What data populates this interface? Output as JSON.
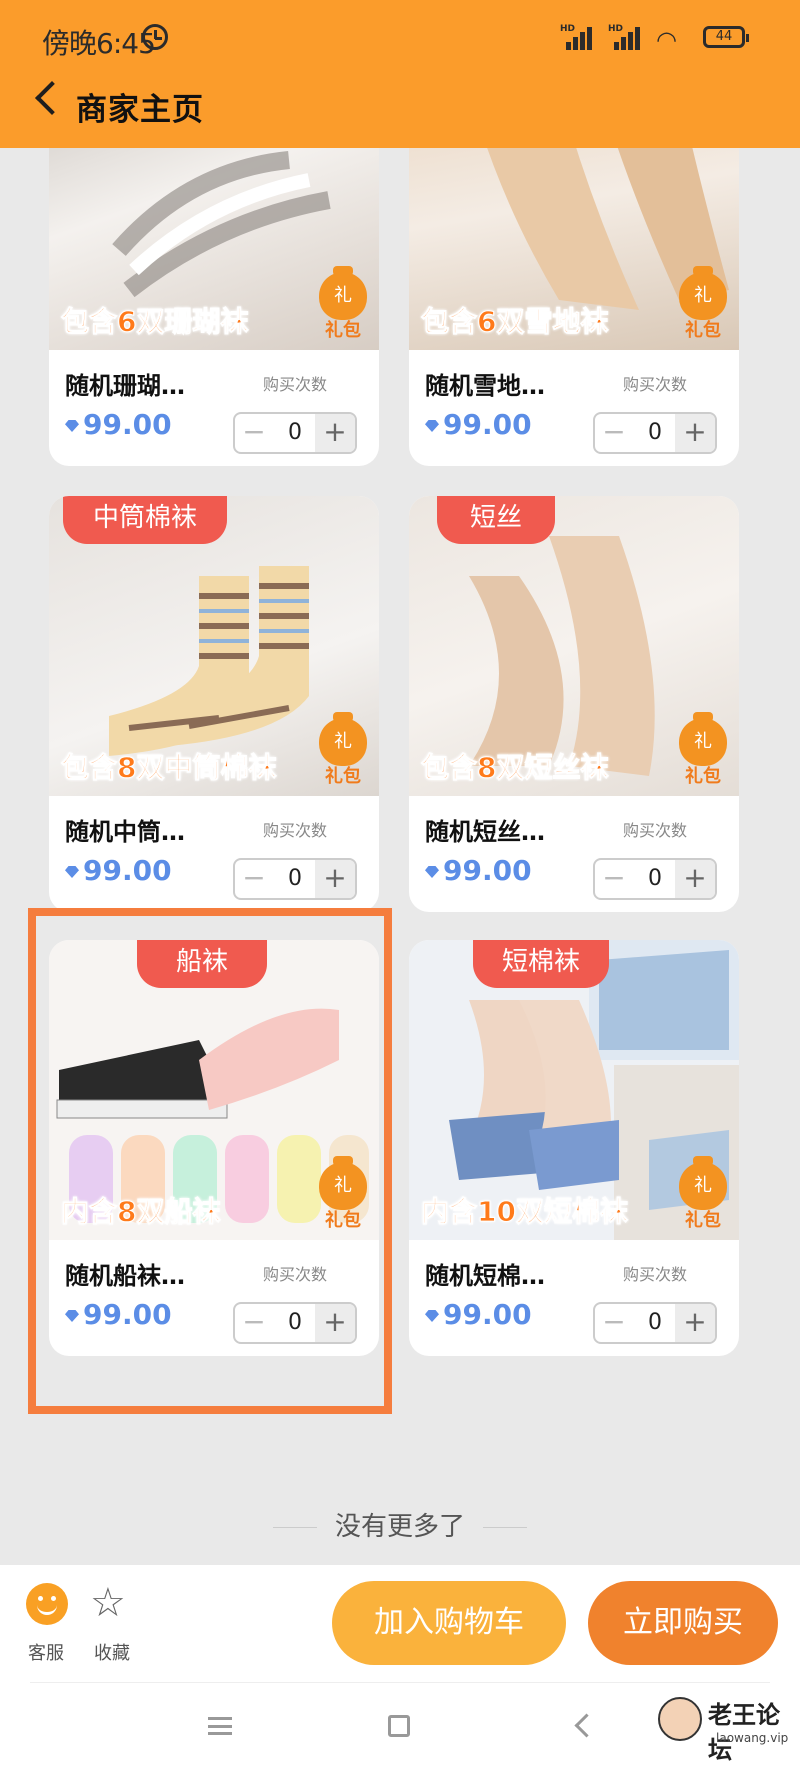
{
  "status_bar": {
    "time": "傍晚6:45",
    "hd": "HD",
    "battery": "44"
  },
  "header": {
    "title": "商家主页"
  },
  "products": [
    {
      "tag": "",
      "caption": "包含6双珊瑚袜",
      "gift_char": "礼",
      "gift_label": "礼包",
      "name": "随机珊瑚…",
      "buy_count_label": "购买次数",
      "price": "99.00",
      "qty": "0",
      "minus": "−",
      "plus": "+"
    },
    {
      "tag": "",
      "caption": "包含6双雪地袜",
      "gift_char": "礼",
      "gift_label": "礼包",
      "name": "随机雪地…",
      "buy_count_label": "购买次数",
      "price": "99.00",
      "qty": "0",
      "minus": "−",
      "plus": "+"
    },
    {
      "tag": "中筒棉袜",
      "caption": "包含8双中筒棉袜",
      "gift_char": "礼",
      "gift_label": "礼包",
      "name": "随机中筒…",
      "buy_count_label": "购买次数",
      "price": "99.00",
      "qty": "0",
      "minus": "−",
      "plus": "+"
    },
    {
      "tag": "短丝",
      "caption": "包含8双短丝袜",
      "gift_char": "礼",
      "gift_label": "礼包",
      "name": "随机短丝…",
      "buy_count_label": "购买次数",
      "price": "99.00",
      "qty": "0",
      "minus": "−",
      "plus": "+"
    },
    {
      "tag": "船袜",
      "caption": "内含8双船袜",
      "gift_char": "礼",
      "gift_label": "礼包",
      "name": "随机船袜…",
      "buy_count_label": "购买次数",
      "price": "99.00",
      "qty": "0",
      "minus": "−",
      "plus": "+"
    },
    {
      "tag": "短棉袜",
      "caption": "内含10双短棉袜",
      "gift_char": "礼",
      "gift_label": "礼包",
      "name": "随机短棉…",
      "buy_count_label": "购买次数",
      "price": "99.00",
      "qty": "0",
      "minus": "−",
      "plus": "+"
    }
  ],
  "footer_note": "没有更多了",
  "bottom_bar": {
    "service_label": "客服",
    "favorite_label": "收藏",
    "add_cart_label": "加入购物车",
    "buy_now_label": "立即购买"
  },
  "watermark": {
    "name": "老王论坛",
    "url": "laowang.vip"
  },
  "colors": {
    "header": "#fb9c2b",
    "tag": "#f05a4f",
    "caption": "#ff7a1a",
    "price": "#5b8de6",
    "cart_button": "#fab23c",
    "buy_button": "#f0822d",
    "highlight": "#f57d3e"
  },
  "icons": [
    "alarm-icon",
    "signal-icon",
    "wifi-icon",
    "battery-icon",
    "back-icon",
    "diamond-icon",
    "gift-bag-icon",
    "smiley-service-icon",
    "star-icon",
    "menu-icon",
    "home-icon",
    "back-nav-icon"
  ]
}
